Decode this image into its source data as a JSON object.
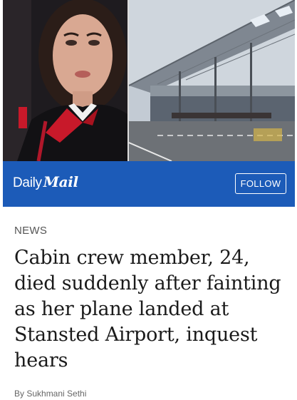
{
  "brand": {
    "daily": "Daily",
    "mail": "Mail",
    "bar_color": "#1c5bb8"
  },
  "follow_label": "FOLLOW",
  "section_label": "NEWS",
  "headline": "Cabin crew member, 24, died suddenly after fainting as her plane landed at Stansted Airport, inquest hears",
  "byline": "By Sukhmani Sethi",
  "photos": {
    "left": "portrait-photo",
    "right": "airport-terminal-photo"
  }
}
